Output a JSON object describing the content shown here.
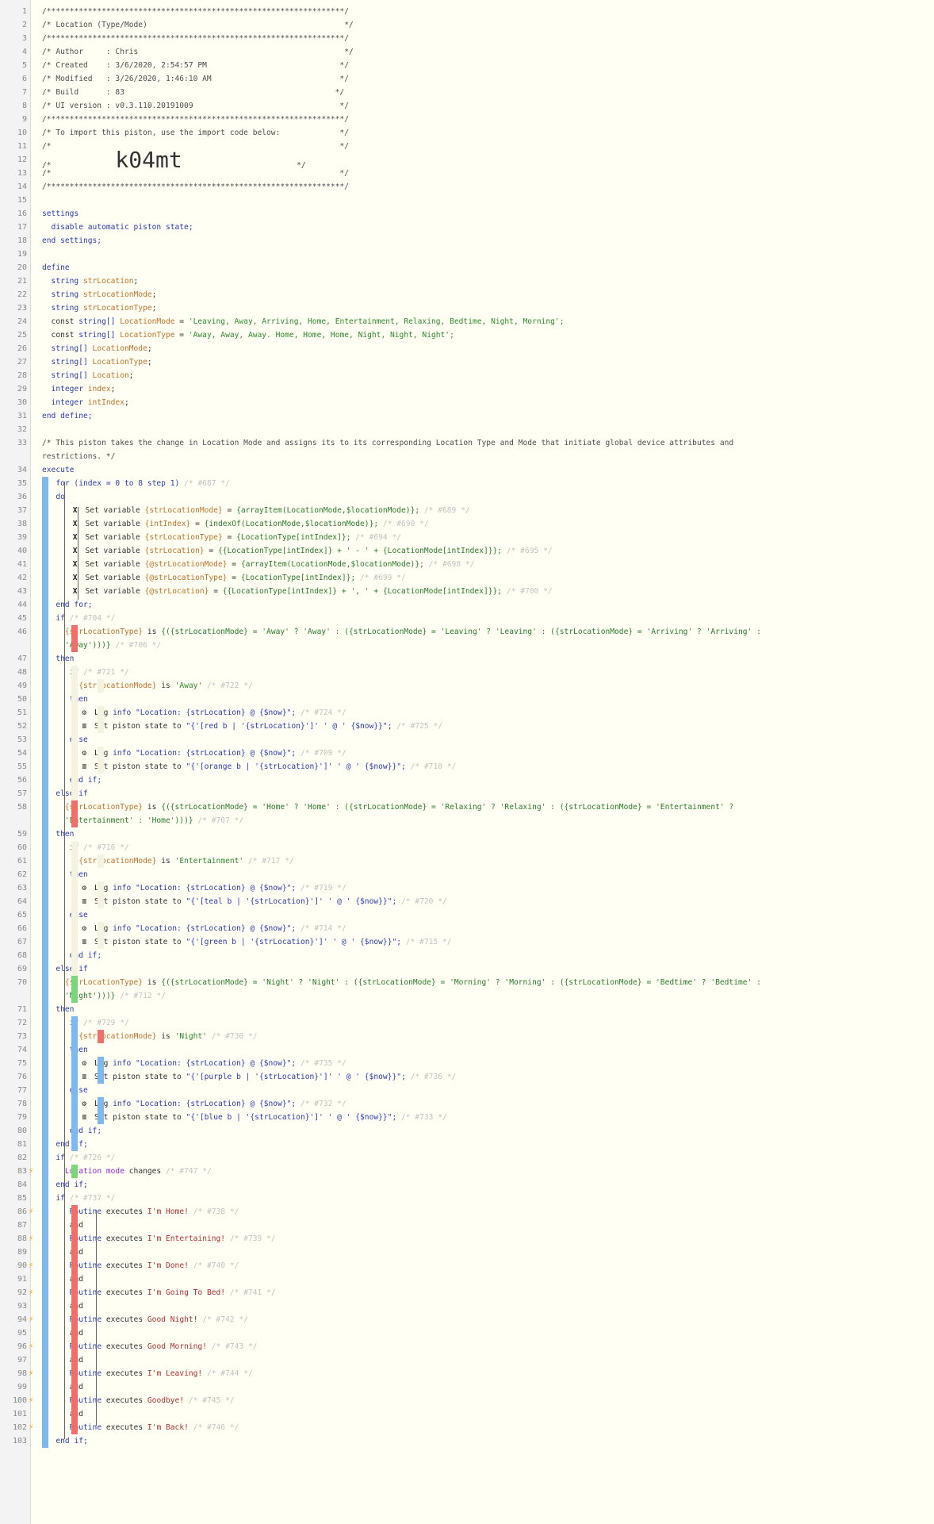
{
  "colors": {
    "blue": "#7db8ef",
    "red": "#f06f6a",
    "green": "#7bd67b",
    "gutter": "#f3f3f3",
    "code_bg": "#fffff4"
  },
  "header": {
    "stars": "/*****************************************************************/",
    "title": "/* Location (Type/Mode)                                           */",
    "author": "/* Author     : Chris                                             */",
    "created": "/* Created    : 3/6/2020, 2:54:57 PM                             */",
    "modified": "/* Modified   : 3/26/2020, 1:46:10 AM                            */",
    "build": "/* Build      : 83                                              */",
    "ui": "/* UI version : v0.3.110.20191009                                */",
    "import": "/* To import this piston, use the import code below:             */",
    "blank": "/*                                                               */",
    "code_prefix": "/*              ",
    "code": "k04mt",
    "code_suffix": "                         */"
  },
  "settings": {
    "open": "settings",
    "item": "disable automatic piston state;",
    "close": "end settings;"
  },
  "define": {
    "open": "define",
    "vars": [
      {
        "type": "string",
        "name": "strLocation"
      },
      {
        "type": "string",
        "name": "strLocationMode"
      },
      {
        "type": "string",
        "name": "strLocationType"
      }
    ],
    "const1": {
      "kw": "const",
      "type": "string[]",
      "name": "LocationMode",
      "eq": " = ",
      "val": "'Leaving, Away, Arriving, Home, Entertainment, Relaxing, Bedtime, Night, Morning';"
    },
    "const2": {
      "kw": "const",
      "type": "string[]",
      "name": "LocationType",
      "eq": " = ",
      "val": "'Away, Away, Away. Home, Home, Home, Night, Night, Night';"
    },
    "arrs": [
      {
        "type": "string[]",
        "name": "LocationMode"
      },
      {
        "type": "string[]",
        "name": "LocationType"
      },
      {
        "type": "string[]",
        "name": "Location"
      }
    ],
    "ints": [
      {
        "type": "integer",
        "name": "index"
      },
      {
        "type": "integer",
        "name": "intIndex"
      }
    ],
    "close": "end define;"
  },
  "comment": {
    "l1": "/* This piston takes the change in Location Mode and assigns its to its corresponding Location Type and Mode that initiate global device attributes and",
    "l2": "restrictions. */"
  },
  "execute": "execute",
  "for_loop": {
    "head": "for (index = 0 to 8 step 1)",
    "cm": "/* #687 */",
    "do": "do",
    "end": "end for;"
  },
  "sets": [
    {
      "label": "Set variable",
      "var": "{strLocationMode}",
      "expr": "{arrayItem(LocationMode,$locationMode)};",
      "cm": "/* #689 */"
    },
    {
      "label": "Set variable",
      "var": "{intIndex}",
      "expr": "{indexOf(LocationMode,$locationMode)};",
      "cm": "/* #690 */"
    },
    {
      "label": "Set variable",
      "var": "{strLocationType}",
      "expr": "{LocationType[intIndex]};",
      "cm": "/* #694 */"
    },
    {
      "label": "Set variable",
      "var": "{strLocation}",
      "expr": "{{LocationType[intIndex]} + ' - ' + {LocationMode[intIndex]}};",
      "cm": "/* #695 */"
    },
    {
      "label": "Set variable",
      "var": "{@strLocationMode}",
      "expr": "{arrayItem(LocationMode,$locationMode)};",
      "cm": "/* #698 */"
    },
    {
      "label": "Set variable",
      "var": "{@strLocationType}",
      "expr": "{LocationType[intIndex]};",
      "cm": "/* #699 */"
    },
    {
      "label": "Set variable",
      "var": "{@strLocation}",
      "expr": "{{LocationType[intIndex]} + ', ' + {LocationMode[intIndex]}};",
      "cm": "/* #700 */"
    }
  ],
  "kw": {
    "if": "if",
    "then": "then",
    "else": "else",
    "else_if": "else if",
    "end_if": "end if;",
    "is": "is",
    "and": "and"
  },
  "cond1": {
    "cm": "/* #704 */",
    "var": "{strLocationType}",
    "op": "is",
    "expr1": "{({strLocationMode} = 'Away' ? 'Away' : ({strLocationMode} = 'Leaving' ? 'Leaving' : ({strLocationMode} = 'Arriving' ? 'Arriving' :",
    "expr2": "'Away')))}",
    "cm2": "/* #706 */"
  },
  "cond2": {
    "cm": "/* #707 */",
    "var": "{strLocationType}",
    "op": "is",
    "expr1": "{({strLocationMode} = 'Home' ? 'Home' : ({strLocationMode} = 'Relaxing' ? 'Relaxing' : ({strLocationMode} = 'Entertainment' ?",
    "expr2": "'Entertainment' : 'Home')))}"
  },
  "cond3": {
    "cm": "/* #712 */",
    "var": "{strLocationType}",
    "op": "is",
    "expr1": "{({strLocationMode} = 'Night' ? 'Night' : ({strLocationMode} = 'Morning' ? 'Morning' : ({strLocationMode} = 'Bedtime' ? 'Bedtime' :",
    "expr2": "'Night')))}"
  },
  "inner": [
    {
      "if_cm": "/* #721 */",
      "var": "{strLocationMode}",
      "val": "'Away'",
      "cm": "/* #722 */",
      "log1": {
        "lbl": "Log",
        "lvl": "info",
        "msg": "\"Location: {strLocation} @ {$now}\";",
        "cm": "/* #724 */"
      },
      "st1": {
        "lbl": "Set piston state to",
        "msg": "\"{'[red b | '{strLocation}']' ' @ ' {$now}}\";",
        "cm": "/* #725 */"
      },
      "log2": {
        "lbl": "Log",
        "lvl": "info",
        "msg": "\"Location: {strLocation} @ {$now}\";",
        "cm": "/* #709 */"
      },
      "st2": {
        "lbl": "Set piston state to",
        "msg": "\"{'[orange b | '{strLocation}']' ' @ ' {$now}}\";",
        "cm": "/* #710 */"
      }
    },
    {
      "if_cm": "/* #716 */",
      "var": "{strLocationMode}",
      "val": "'Entertainment'",
      "cm": "/* #717 */",
      "log1": {
        "lbl": "Log",
        "lvl": "info",
        "msg": "\"Location: {strLocation} @ {$now}\";",
        "cm": "/* #719 */"
      },
      "st1": {
        "lbl": "Set piston state to",
        "msg": "\"{'[teal b | '{strLocation}']' ' @ ' {$now}}\";",
        "cm": "/* #720 */"
      },
      "log2": {
        "lbl": "Log",
        "lvl": "info",
        "msg": "\"Location: {strLocation} @ {$now}\";",
        "cm": "/* #714 */"
      },
      "st2": {
        "lbl": "Set piston state to",
        "msg": "\"{'[green b | '{strLocation}']' ' @ ' {$now}}\";",
        "cm": "/* #715 */"
      }
    },
    {
      "if_cm": "/* #729 */",
      "var": "{strLocationMode}",
      "val": "'Night'",
      "cm": "/* #730 */",
      "log1": {
        "lbl": "Log",
        "lvl": "info",
        "msg": "\"Location: {strLocation} @ {$now}\";",
        "cm": "/* #735 */"
      },
      "st1": {
        "lbl": "Set piston state to",
        "msg": "\"{'[purple b | '{strLocation}']' ' @ ' {$now}}\";",
        "cm": "/* #736 */"
      },
      "log2": {
        "lbl": "Log",
        "lvl": "info",
        "msg": "\"Location: {strLocation} @ {$now}\";",
        "cm": "/* #732 */"
      },
      "st2": {
        "lbl": "Set piston state to",
        "msg": "\"{'[blue b | '{strLocation}']' ' @ ' {$now}}\";",
        "cm": "/* #733 */"
      }
    }
  ],
  "trigger_if": {
    "cm": "/* #726 */",
    "subj": "Location mode",
    "verb": "changes",
    "cm2": "/* #747 */"
  },
  "routine_if": {
    "cm": "/* #737 */"
  },
  "routines": [
    {
      "subj": "Routine",
      "verb": "executes",
      "name": "I'm Home!",
      "cm": "/* #738 */"
    },
    {
      "subj": "Routine",
      "verb": "executes",
      "name": "I'm Entertaining!",
      "cm": "/* #739 */"
    },
    {
      "subj": "Routine",
      "verb": "executes",
      "name": "I'm Done!",
      "cm": "/* #740 */"
    },
    {
      "subj": "Routine",
      "verb": "executes",
      "name": "I'm Going To Bed!",
      "cm": "/* #741 */"
    },
    {
      "subj": "Routine",
      "verb": "executes",
      "name": "Good Night!",
      "cm": "/* #742 */"
    },
    {
      "subj": "Routine",
      "verb": "executes",
      "name": "Good Morning!",
      "cm": "/* #743 */"
    },
    {
      "subj": "Routine",
      "verb": "executes",
      "name": "I'm Leaving!",
      "cm": "/* #744 */"
    },
    {
      "subj": "Routine",
      "verb": "executes",
      "name": "Goodbye!",
      "cm": "/* #745 */"
    },
    {
      "subj": "Routine",
      "verb": "executes",
      "name": "I'm Back!",
      "cm": "/* #746 */"
    }
  ],
  "icons": {
    "set": "x-icon",
    "log": "bug-icon",
    "state": "list-icon",
    "trigger": "bolt-icon"
  }
}
